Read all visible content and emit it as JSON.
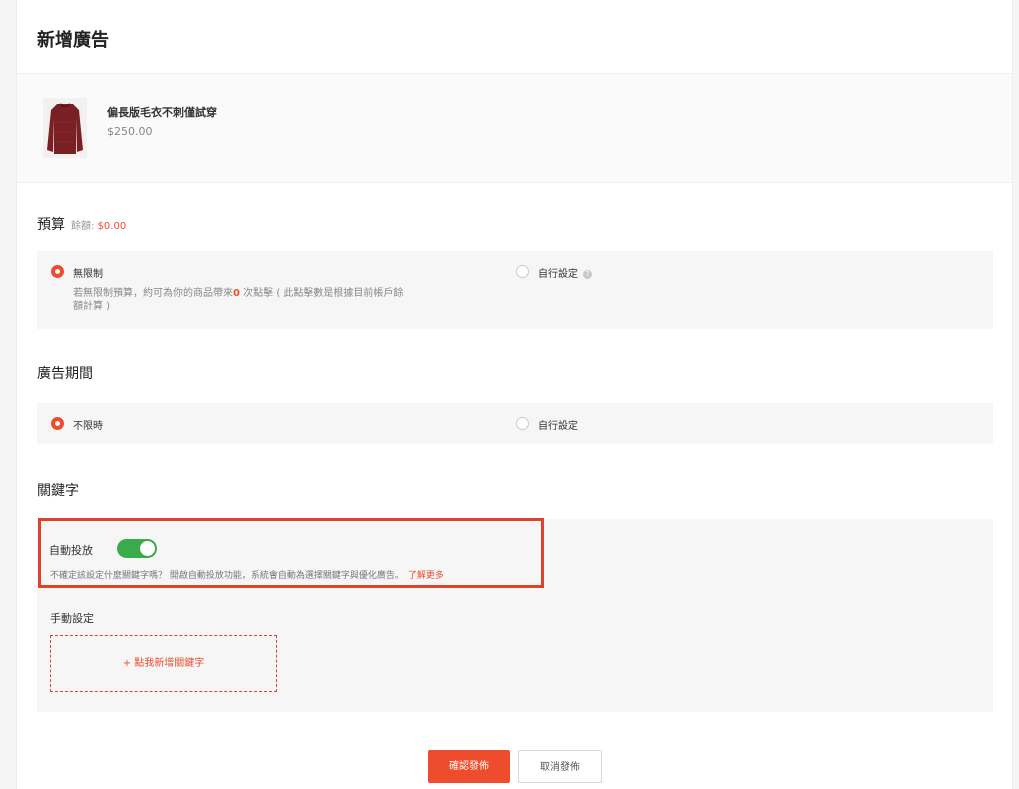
{
  "page_title": "新增廣告",
  "product": {
    "name": "偏長版毛衣不刺僅試穿",
    "price": "$250.00"
  },
  "budget": {
    "title": "預算",
    "balance_label": "餘額:",
    "balance_value": "$0.00",
    "options": {
      "unlimited": {
        "label": "無限制",
        "desc_before": "若無限制預算，約可為你的商品帶來",
        "desc_count": "0",
        "desc_after": " 次點擊 ( 此點擊數是根據目前帳戶餘額計算 )"
      },
      "custom": {
        "label": "自行設定",
        "help_icon": "?"
      }
    },
    "selected": "unlimited"
  },
  "period": {
    "title": "廣告期間",
    "options": {
      "unlimited": {
        "label": "不限時"
      },
      "custom": {
        "label": "自行設定"
      }
    },
    "selected": "unlimited"
  },
  "keywords": {
    "title": "關鍵字",
    "auto": {
      "label": "自動投放",
      "enabled": true,
      "desc": "不確定該設定什麼關鍵字嗎？ 開啟自動投放功能，系統會自動為選擇關鍵字與優化廣告。",
      "learn_more": "了解更多"
    },
    "manual": {
      "label": "手動設定",
      "add_button": "+ 點我新增關鍵字"
    }
  },
  "actions": {
    "confirm": "確認發佈",
    "cancel": "取消發佈"
  },
  "colors": {
    "accent": "#ee4d2d",
    "toggle_on": "#3aaa4a"
  }
}
